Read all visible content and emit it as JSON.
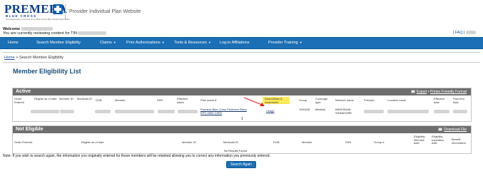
{
  "header": {
    "logo_text": "PREMERA",
    "logo_subtext": "BLUE CROSS",
    "logo_tagline": "An Independent Licensee of the Blue Cross Blue Shield Association",
    "site_title": "Provider Individual Plan Website"
  },
  "welcome": {
    "greeting": "Welcome",
    "tin_text": "You are currently reviewing content for TIN",
    "links": [
      "FAQ"
    ]
  },
  "nav": {
    "items": [
      {
        "label": "Home",
        "has_menu": false
      },
      {
        "label": "Search Member Eligibility",
        "has_menu": false
      },
      {
        "label": "Claims",
        "has_menu": true
      },
      {
        "label": "Prior Authorizations",
        "has_menu": true
      },
      {
        "label": "Tools & Resources",
        "has_menu": true
      },
      {
        "label": "Log-in Affiliations",
        "has_menu": false
      },
      {
        "label": "Provider Training",
        "has_menu": true
      }
    ]
  },
  "breadcrumb": {
    "home": "Home",
    "separator": ">",
    "current": "Search Member Eligibility"
  },
  "page_title": "Member Eligibility List",
  "active_panel": {
    "title": "Active",
    "export_label": "Export",
    "printer_label": "Printer Friendly Format",
    "columns": {
      "order": "Order Entered",
      "eligible": "Eligible as of date",
      "member_id": "Member ID",
      "medicaid_id": "Medicaid ID",
      "dob": "DOB",
      "member": "Member",
      "ssn": "SSN",
      "effective": "Effective dates",
      "plan": "Plan name",
      "deductibles": "Deductibles & maximums",
      "group": "Group",
      "coverage": "Coverage type",
      "network": "Network name",
      "provider": "Provider",
      "location": "Location name",
      "eff_date": "Effective date",
      "past_thru": "Past thru date"
    },
    "row": {
      "plan_name": "Premera Blue Cross Preferred Silver EPO 4500 CSR2",
      "deductibles_link": "Usage",
      "group": "1100015",
      "coverage": "Medical",
      "network": "INDIVIDUAL SIGNATURE"
    },
    "pagination": "1"
  },
  "not_eligible_panel": {
    "title": "Not Eligible",
    "download_label": "Download File",
    "columns": {
      "order": "Order Entered",
      "eligible": "Eligible as of date",
      "member_id": "Member ID",
      "medicaid_id": "Medicaid ID",
      "dob": "DOB",
      "member": "Member",
      "ssn": "SSN",
      "group": "Group #",
      "eligibility_eff": "Eligibility effective date",
      "eligibility_exp": "Eligibility expiration date",
      "benefit": "Benefit information"
    },
    "no_results": "No Results Found"
  },
  "note": "Note: If you wish to search again, the information you originally entered for these members will be retained allowing you to correct any information you previously entered.",
  "search_again_button": "Search Again",
  "colors": {
    "nav_bg": "#1a6fb5",
    "panel_header_bg": "#6e6e6e",
    "title_color": "#1a4f7a",
    "highlight": "#ffe95a",
    "arrow": "#e0242a"
  }
}
